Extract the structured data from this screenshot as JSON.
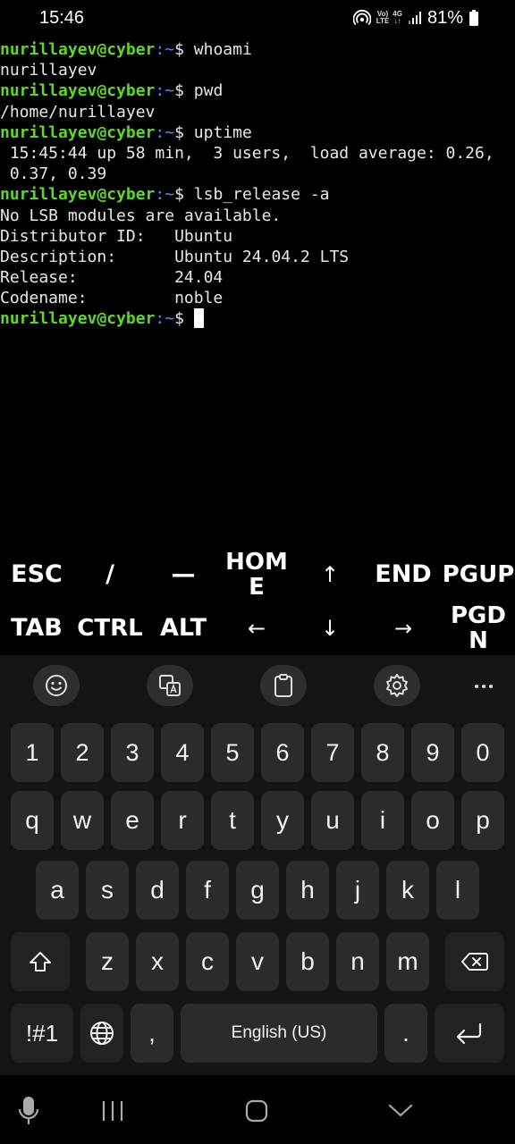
{
  "status_bar": {
    "time": "15:46",
    "volte": "Vo)",
    "lte": "LTE",
    "network": "4G",
    "battery": "81%"
  },
  "terminal": {
    "prompt_user": "nurillayev@cyber",
    "prompt_path": ":~",
    "prompt_symbol": "$ ",
    "lines": [
      {
        "type": "prompt",
        "cmd": "whoami"
      },
      {
        "type": "output",
        "text": "nurillayev"
      },
      {
        "type": "prompt",
        "cmd": "pwd"
      },
      {
        "type": "output",
        "text": "/home/nurillayev"
      },
      {
        "type": "prompt",
        "cmd": "uptime"
      },
      {
        "type": "output",
        "text": " 15:45:44 up 58 min,  3 users,  load average: 0.26,"
      },
      {
        "type": "output",
        "text": " 0.37, 0.39"
      },
      {
        "type": "prompt",
        "cmd": "lsb_release -a"
      },
      {
        "type": "output",
        "text": "No LSB modules are available."
      },
      {
        "type": "output",
        "text": "Distributor ID:\tUbuntu"
      },
      {
        "type": "output",
        "text": "Description:\tUbuntu 24.04.2 LTS"
      },
      {
        "type": "output",
        "text": "Release:\t24.04"
      },
      {
        "type": "output",
        "text": "Codename:\tnoble"
      },
      {
        "type": "prompt",
        "cmd": "",
        "cursor": true
      }
    ]
  },
  "extra_keys": {
    "row1": [
      "ESC",
      "/",
      "—",
      "HOME",
      "↑",
      "END",
      "PGUP"
    ],
    "row2": [
      "TAB",
      "CTRL",
      "ALT",
      "←",
      "↓",
      "→",
      "PGDN"
    ]
  },
  "keyboard": {
    "toolbar": [
      "emoji-icon",
      "translate-icon",
      "clipboard-icon",
      "settings-icon",
      "more-icon"
    ],
    "numbers": [
      "1",
      "2",
      "3",
      "4",
      "5",
      "6",
      "7",
      "8",
      "9",
      "0"
    ],
    "row1": [
      "q",
      "w",
      "e",
      "r",
      "t",
      "y",
      "u",
      "i",
      "o",
      "p"
    ],
    "row2": [
      "a",
      "s",
      "d",
      "f",
      "g",
      "h",
      "j",
      "k",
      "l"
    ],
    "row3": [
      "z",
      "x",
      "c",
      "v",
      "b",
      "n",
      "m"
    ],
    "symbols_key": "!#1",
    "comma": ",",
    "space_label": "English (US)",
    "period": "."
  },
  "nav_bar": {
    "items": [
      "mic-icon",
      "recents-icon",
      "home-icon",
      "hide-keyboard-icon"
    ]
  }
}
